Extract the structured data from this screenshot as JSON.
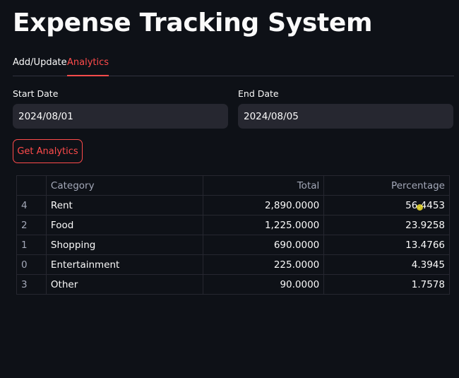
{
  "app": {
    "title": "Expense Tracking System"
  },
  "tabs": [
    {
      "label": "Add/Update",
      "active": false
    },
    {
      "label": "Analytics",
      "active": true
    }
  ],
  "form": {
    "start_date": {
      "label": "Start Date",
      "value": "2024/08/01"
    },
    "end_date": {
      "label": "End Date",
      "value": "2024/08/05"
    },
    "button_label": "Get Analytics"
  },
  "table": {
    "columns": [
      "",
      "Category",
      "Total",
      "Percentage"
    ],
    "rows": [
      {
        "index": "4",
        "category": "Rent",
        "total": "2,890.0000",
        "percentage": "56.4453"
      },
      {
        "index": "2",
        "category": "Food",
        "total": "1,225.0000",
        "percentage": "23.9258"
      },
      {
        "index": "1",
        "category": "Shopping",
        "total": "690.0000",
        "percentage": "13.4766"
      },
      {
        "index": "0",
        "category": "Entertainment",
        "total": "225.0000",
        "percentage": "4.3945"
      },
      {
        "index": "3",
        "category": "Other",
        "total": "90.0000",
        "percentage": "1.7578"
      }
    ]
  },
  "colors": {
    "background": "#0e1117",
    "accent": "#ff4b4b",
    "input_background": "#262730",
    "cursor_highlight": "#f0e130"
  }
}
